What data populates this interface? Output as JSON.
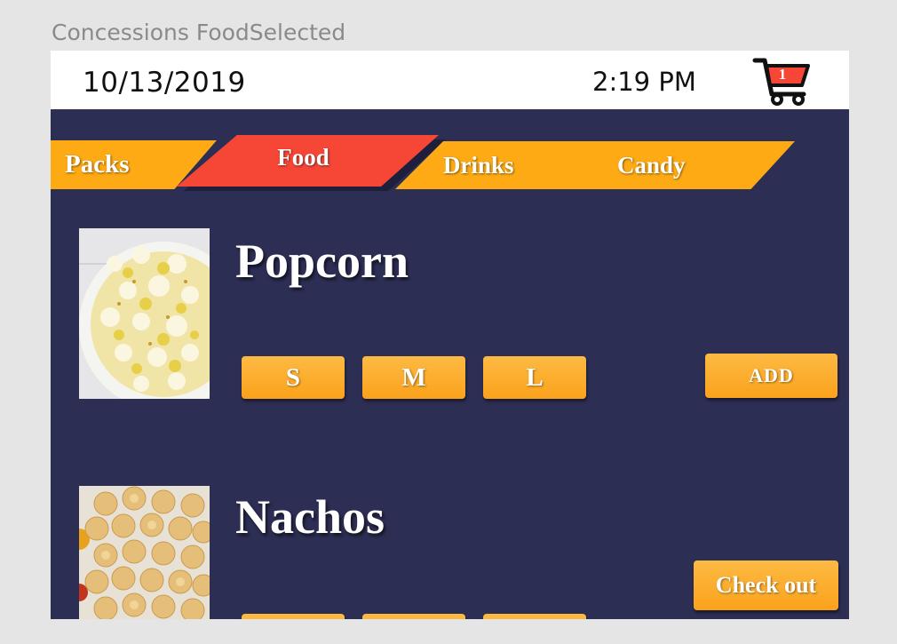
{
  "artboard": {
    "title": "Concessions FoodSelected"
  },
  "status_bar": {
    "date": "10/13/2019",
    "time": "2:19 PM",
    "cart_count": "1",
    "cart_color": "#f54636"
  },
  "tabs": [
    {
      "label": "Packs",
      "selected": false
    },
    {
      "label": "Food",
      "selected": true
    },
    {
      "label": "Drinks",
      "selected": false
    },
    {
      "label": "Candy",
      "selected": false
    }
  ],
  "items": [
    {
      "name": "Popcorn",
      "image_icon": "popcorn-photo",
      "sizes": [
        "S",
        "M",
        "L"
      ],
      "add_label": "ADD"
    },
    {
      "name": "Nachos",
      "image_icon": "nachos-photo",
      "sizes": [
        "",
        "",
        ""
      ]
    }
  ],
  "checkout_label": "Check out",
  "colors": {
    "background": "#2d2e54",
    "accent": "#fdaa14",
    "selected_tab": "#f54636"
  }
}
